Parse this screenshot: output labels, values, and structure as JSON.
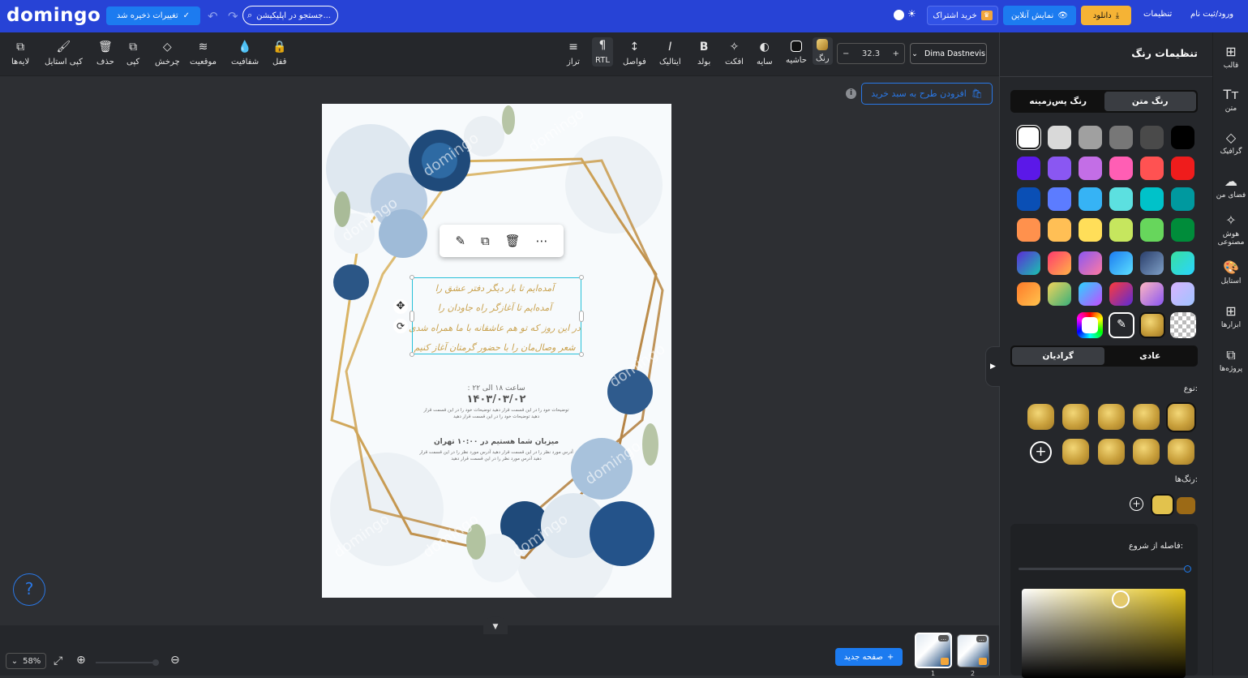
{
  "topbar": {
    "logo": "domingo",
    "save_status": "تغییرات ذخیره شد",
    "search_placeholder": "جستجو در اپلیکیشن...",
    "subscribe": "خرید اشتراک",
    "live_preview": "نمایش آنلاین",
    "download": "دانلود",
    "settings": "تنظیمات",
    "login": "ورود/ثبت نام"
  },
  "toolbar": {
    "left_tools": [
      "لایه‌ها",
      "کپی استایل",
      "حذف",
      "کپی",
      "چرخش",
      "موقعیت",
      "شفافیت",
      "قفل"
    ],
    "text_tools": [
      "تراز",
      "RTL",
      "فواصل",
      "ایتالیک",
      "بولد",
      "افکت",
      "سایه",
      "حاشیه",
      "رنگ"
    ],
    "font_size": "32.3",
    "font_name": "Dima Dastnevis"
  },
  "canvas": {
    "add_to_cart": "افزودن طرح به سبد خرید",
    "watermark": "domingo",
    "poem": [
      "آمده‌ایم تا بار دیگر دفتر عشق را",
      "آمده‌ایم تا آغازگر راه جاودان را",
      "در این روز که تو هم عاشقانه با ما همراه شدی",
      "شعر وصال‌مان را با حضور گرمتان آغاز کنیم"
    ],
    "date_line": ": ساعت ۱۸ الی ۲۲",
    "date": "۱۴۰۳/۰۳/۰۲",
    "body_lines": [
      "توضیحات خود را در این قسمت قرار دهید توضیحات خود را در این قسمت قرار",
      "دهید توضیحات خود را در این قسمت قرار دهید"
    ],
    "host_title": "میزبان شما هستیم در ۱۰:۰۰ تهران",
    "address_lines": [
      "آدرس مورد نظر را در این قسمت قرار دهید آدرس مورد نظر را در این قسمت قرار",
      "دهید آدرس مورد نظر را در این قسمت قرار دهید"
    ]
  },
  "bottom": {
    "zoom": "58%",
    "new_page": "صفحه جدید",
    "pages": [
      "1",
      "2"
    ],
    "help": "?"
  },
  "color_panel": {
    "title": "تنظیمات رنگ",
    "tabs": [
      "رنگ متن",
      "رنگ پس‌زمینه"
    ],
    "mode_tabs": [
      "عادی",
      "گرادیان"
    ],
    "type_label": "نوع:",
    "colors_label": "رنگ‌ها:",
    "offset_label": "فاصله از شروع:",
    "swatches": [
      [
        "#000000",
        "#4a4a4a",
        "#777777",
        "#a0a0a0",
        "#d9d9d9",
        "#ffffff"
      ],
      [
        "#ef1c1c",
        "#ff5252",
        "#ff5eb4",
        "#c36ee6",
        "#8a57f2",
        "#5b18e8"
      ],
      [
        "#00999f",
        "#00c2c9",
        "#5ce0e0",
        "#36b3f5",
        "#5c7cff",
        "#0a4fb5"
      ],
      [
        "#008c3a",
        "#67d65c",
        "#c6e65e",
        "#ffde59",
        "#ffbf55",
        "#ff914d"
      ]
    ]
  },
  "sidebar": {
    "items": [
      "قالب",
      "متن",
      "گرافیک",
      "فضای من",
      "هوش مصنوعی",
      "استایل",
      "ابزارها",
      "پروژه‌ها"
    ]
  }
}
